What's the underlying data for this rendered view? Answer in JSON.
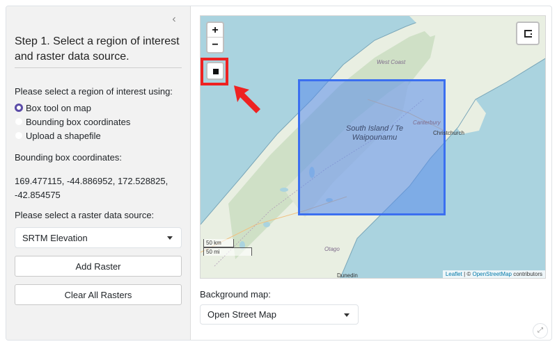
{
  "sidebar": {
    "collapse_icon": "chevron-left-icon",
    "collapse_glyph": "‹",
    "title": "Step 1. Select a region of interest and raster data source.",
    "roi_label": "Please select a region of interest using:",
    "roi_options": [
      {
        "label": "Box tool on map",
        "checked": true
      },
      {
        "label": "Bounding box coordinates",
        "checked": false
      },
      {
        "label": "Upload a shapefile",
        "checked": false
      }
    ],
    "bbox_label": "Bounding box coordinates:",
    "bbox_value": "169.477115, -44.886952, 172.528825, -42.854575",
    "raster_label": "Please select a raster data source:",
    "raster_selected": "SRTM Elevation",
    "add_raster": "Add Raster",
    "clear_rasters": "Clear All Rasters"
  },
  "map": {
    "zoom_in": "+",
    "zoom_out": "−",
    "labels": {
      "west_coast": "West Coast",
      "canterbury": "Canterbury",
      "christchurch": "Christchurch",
      "otago": "Otago",
      "dunedin": "Dunedin",
      "island": "South Island / Te Waipounamu"
    },
    "scale_km": "50 km",
    "scale_mi": "50 mi",
    "attribution": {
      "leaflet": "Leaflet",
      "sep": " | © ",
      "osm": "OpenStreetMap",
      "contributors": " contributors"
    },
    "colors": {
      "water": "#aad3df",
      "land": "#e8ede0",
      "selection": "#3b6ff0",
      "highlight": "#ee2222"
    }
  },
  "background": {
    "label": "Background map:",
    "selected": "Open Street Map"
  }
}
